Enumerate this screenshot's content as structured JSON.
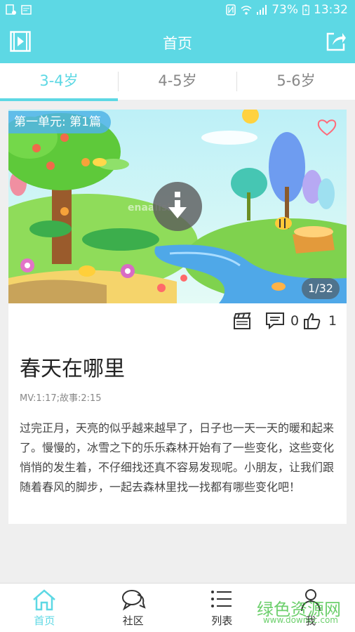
{
  "status_bar": {
    "battery": "73%",
    "time": "13:32"
  },
  "header": {
    "title": "首页",
    "left_icon": "video-play-icon",
    "right_icon": "share-icon"
  },
  "tabs": [
    {
      "label": "3-4岁",
      "active": true
    },
    {
      "label": "4-5岁",
      "active": false
    },
    {
      "label": "5-6岁",
      "active": false
    }
  ],
  "card": {
    "unit_badge": "第一单元: 第1篇",
    "page_counter": "1/32",
    "comments_count": "0",
    "likes_count": "1",
    "title": "春天在哪里",
    "duration": "MV:1:17;故事:2:15",
    "description": "过完正月，天亮的似乎越来越早了，日子也一天一天的暖和起来了。慢慢的，冰雪之下的乐乐森林开始有了一些变化，这些变化悄悄的发生着，不仔细找还真不容易发现呢。小朋友，让我们跟随着春风的脚步，一起去森林里找一找都有哪些变化吧！",
    "cover_watermark": "enaalish"
  },
  "bottom_nav": [
    {
      "label": "首页",
      "icon": "home-icon",
      "active": true
    },
    {
      "label": "社区",
      "icon": "chat-bubble-icon",
      "active": false
    },
    {
      "label": "列表",
      "icon": "list-icon",
      "active": false
    },
    {
      "label": "我",
      "icon": "person-icon",
      "active": false
    }
  ],
  "site_watermark": {
    "main": "绿色资源网",
    "sub": "www.downcc.com"
  },
  "colors": {
    "accent": "#5dd8e4"
  }
}
